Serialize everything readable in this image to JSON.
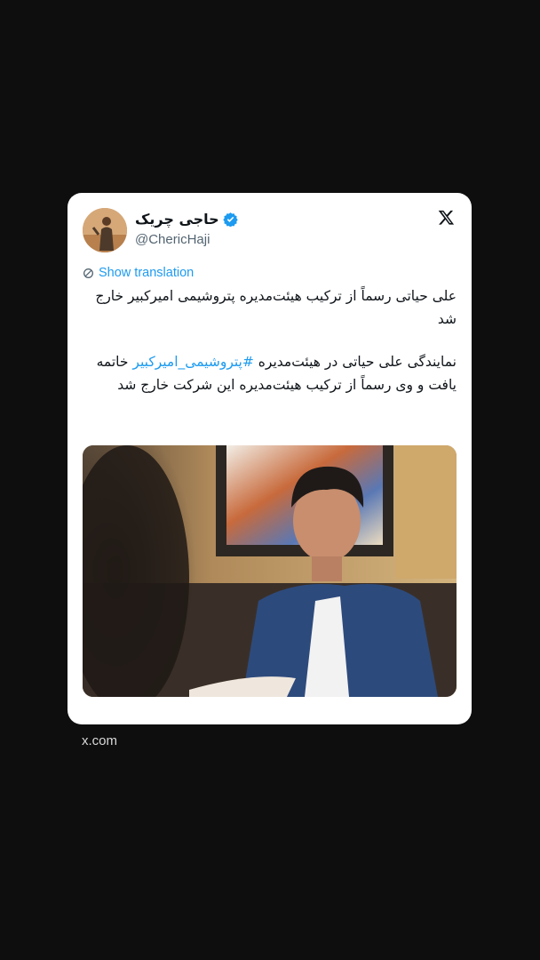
{
  "tweet": {
    "author_name": "حاجی چریک",
    "author_handle": "@ChericHaji",
    "show_translation_label": "Show translation",
    "paragraph1": "علی حیاتی رسماً از ترکیب هیئت‌مدیره پتروشیمی امیرکبیر خارج شد",
    "paragraph2_part1": "نمایندگی علی حیاتی در هیئت‌مدیره ",
    "paragraph2_hashtag": "#پتروشیمی_امیرکبیر",
    "paragraph2_part2": " خاتمه یافت و وی رسماً از ترکیب هیئت‌مدیره این شرکت خارج شد",
    "verified": true,
    "icons": {
      "platform": "x-logo-icon",
      "verified": "verified-badge-icon",
      "translate": "translate-icon"
    }
  },
  "footer": {
    "source_domain": "x.com"
  },
  "colors": {
    "background": "#0e0e0e",
    "card": "#ffffff",
    "link_blue": "#1d9bf0",
    "handle_gray": "#536471",
    "text": "#0f1419"
  }
}
